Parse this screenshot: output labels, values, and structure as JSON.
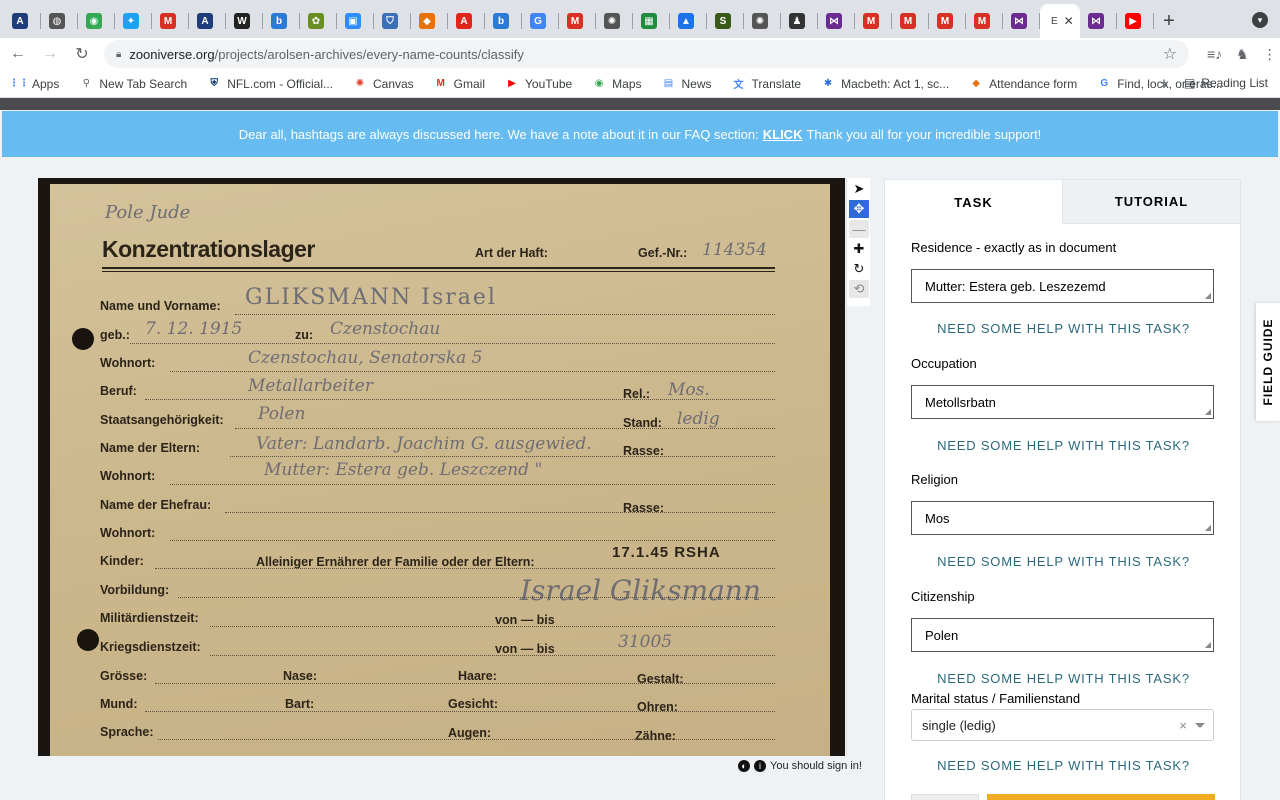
{
  "browser": {
    "tabs": [
      {
        "icon": "arolsen-icon",
        "color": "#1f3d7a",
        "glyph": "A"
      },
      {
        "icon": "globe-icon",
        "color": "#555555",
        "glyph": "◍"
      },
      {
        "icon": "maps-icon",
        "color": "#34a853",
        "glyph": "◉"
      },
      {
        "icon": "twitter-icon",
        "color": "#1da1f2",
        "glyph": "✦"
      },
      {
        "icon": "gmail-icon",
        "color": "#d93025",
        "glyph": "M"
      },
      {
        "icon": "arolsen-icon",
        "color": "#1f3d7a",
        "glyph": "A"
      },
      {
        "icon": "wikipedia-icon",
        "color": "#222222",
        "glyph": "W"
      },
      {
        "icon": "bing-icon",
        "color": "#2b7bd6",
        "glyph": "b"
      },
      {
        "icon": "badge-icon",
        "color": "#6b8e23",
        "glyph": "✿"
      },
      {
        "icon": "zoom-icon",
        "color": "#2d8cff",
        "glyph": "▣"
      },
      {
        "icon": "shield-icon",
        "color": "#3b6fb6",
        "glyph": "⛉"
      },
      {
        "icon": "attendance-icon",
        "color": "#e8710a",
        "glyph": "◆"
      },
      {
        "icon": "adobe-icon",
        "color": "#e1251b",
        "glyph": "A"
      },
      {
        "icon": "bing-icon",
        "color": "#2b7bd6",
        "glyph": "b"
      },
      {
        "icon": "google-icon",
        "color": "#4285f4",
        "glyph": "G"
      },
      {
        "icon": "gmail-icon",
        "color": "#d93025",
        "glyph": "M"
      },
      {
        "icon": "dotted-circle-icon",
        "color": "#555555",
        "glyph": "✺"
      },
      {
        "icon": "classroom-icon",
        "color": "#1e8e3e",
        "glyph": "▦"
      },
      {
        "icon": "contacts-icon",
        "color": "#1a73e8",
        "glyph": "▲"
      },
      {
        "icon": "sketch-icon",
        "color": "#3a5a1a",
        "glyph": "S"
      },
      {
        "icon": "dotted-circle-icon",
        "color": "#555555",
        "glyph": "✺"
      },
      {
        "icon": "person-icon",
        "color": "#333333",
        "glyph": "♟"
      },
      {
        "icon": "zooniverse-icon",
        "color": "#6b2c91",
        "glyph": "⋈"
      },
      {
        "icon": "gmail-icon",
        "color": "#d93025",
        "glyph": "M"
      },
      {
        "icon": "gmail-icon",
        "color": "#d93025",
        "glyph": "M"
      },
      {
        "icon": "gmail-icon",
        "color": "#d93025",
        "glyph": "M"
      },
      {
        "icon": "gmail-icon",
        "color": "#d93025",
        "glyph": "M"
      },
      {
        "icon": "zooniverse-icon",
        "color": "#6b2c91",
        "glyph": "⋈"
      }
    ],
    "active_tab_label": "E",
    "after_tabs": [
      {
        "icon": "zooniverse-icon",
        "color": "#6b2c91",
        "glyph": "⋈"
      },
      {
        "icon": "youtube-icon",
        "color": "#ff0000",
        "glyph": "▶"
      }
    ],
    "url_host": "zooniverse.org",
    "url_path": "/projects/arolsen-archives/every-name-counts/classify",
    "bookmarks": [
      {
        "label": "Apps",
        "icon": "apps-grid-icon",
        "color": "#4285f4",
        "glyph": "⋮⋮"
      },
      {
        "label": "New Tab Search",
        "icon": "search-icon",
        "color": "#5f6368",
        "glyph": "⚲"
      },
      {
        "label": "NFL.com - Official...",
        "icon": "nfl-icon",
        "color": "#013369",
        "glyph": "⛨"
      },
      {
        "label": "Canvas",
        "icon": "canvas-icon",
        "color": "#e13f2b",
        "glyph": "✺"
      },
      {
        "label": "Gmail",
        "icon": "gmail-icon",
        "color": "#d93025",
        "glyph": "M"
      },
      {
        "label": "YouTube",
        "icon": "youtube-icon",
        "color": "#ff0000",
        "glyph": "▶"
      },
      {
        "label": "Maps",
        "icon": "maps-icon",
        "color": "#34a853",
        "glyph": "◉"
      },
      {
        "label": "News",
        "icon": "news-icon",
        "color": "#4285f4",
        "glyph": "▤"
      },
      {
        "label": "Translate",
        "icon": "translate-icon",
        "color": "#4285f4",
        "glyph": "文"
      },
      {
        "label": "Macbeth: Act 1, sc...",
        "icon": "asterisk-icon",
        "color": "#2a6fd6",
        "glyph": "✱"
      },
      {
        "label": "Attendance form",
        "icon": "attendance-icon",
        "color": "#e8710a",
        "glyph": "◆"
      },
      {
        "label": "Find, lock, or eras...",
        "icon": "google-icon",
        "color": "#4285f4",
        "glyph": "G"
      }
    ],
    "bookmarks_more": "»",
    "reading_list": "Reading List"
  },
  "banner": {
    "before": "Dear all, hashtags are always discussed here. We have a note about it in our FAQ section:",
    "link": "KLICK",
    "after": "Thank you all for your incredible support!"
  },
  "card": {
    "note_top": "Pole Jude",
    "title": "Konzentrationslager",
    "art_der_haft": "Art der Haft:",
    "gef_nr_label": "Gef.-Nr.:",
    "gef_nr": "114354",
    "name_label": "Name und Vorname:",
    "name": "GLIKSMANN Israel",
    "geb_label": "geb.:",
    "geb": "7. 12. 1915",
    "zu_label": "zu:",
    "zu": "Czenstochau",
    "wohnort_label": "Wohnort:",
    "wohnort": "Czenstochau, Senatorska 5",
    "beruf_label": "Beruf:",
    "beruf": "Metallarbeiter",
    "rel_label": "Rel.:",
    "rel": "Mos.",
    "staat_label": "Staatsangehörigkeit:",
    "staat": "Polen",
    "stand_label": "Stand:",
    "stand": "ledig",
    "eltern_label": "Name der Eltern:",
    "eltern": "Vater: Landarb. Joachim G. ausgewied.",
    "rasse_label": "Rasse:",
    "wohnort2_label": "Wohnort:",
    "wohnort2": "Mutter: Estera geb. Leszczend \"",
    "ehefrau_label": "Name der Ehefrau:",
    "rasse2_label": "Rasse:",
    "wohnort3_label": "Wohnort:",
    "kinder_label": "Kinder:",
    "ernaehrer_label": "Alleiniger Ernährer der Familie oder der Eltern:",
    "stamp": "17.1.45 RSHA",
    "vorbildung_label": "Vorbildung:",
    "signature": "Israel Gliksmann",
    "militaer_label": "Militärdienstzeit:",
    "von1": "von — bis",
    "krieg_label": "Kriegsdienstzeit:",
    "von2": "von — bis",
    "number2": "31005",
    "groesse_label": "Grösse:",
    "nase_label": "Nase:",
    "haare_label": "Haare:",
    "gestalt_label": "Gestalt:",
    "mund_label": "Mund:",
    "bart_label": "Bart:",
    "gesicht_label": "Gesicht:",
    "ohren_label": "Ohren:",
    "sprache_label": "Sprache:",
    "augen_label": "Augen:",
    "zaehne_label": "Zähne:"
  },
  "viewer": {
    "tools": [
      {
        "name": "pointer-tool-icon",
        "glyph": "➤",
        "state": "normal"
      },
      {
        "name": "move-tool-icon",
        "glyph": "✥",
        "state": "active"
      },
      {
        "name": "zoom-out-icon",
        "glyph": "—",
        "state": "dim"
      },
      {
        "name": "zoom-in-icon",
        "glyph": "✚",
        "state": "normal"
      },
      {
        "name": "rotate-icon",
        "glyph": "↻",
        "state": "normal"
      },
      {
        "name": "reset-icon",
        "glyph": "⟲",
        "state": "dim"
      }
    ],
    "signin": "You should sign in!"
  },
  "panel": {
    "tab_task": "TASK",
    "tab_tutorial": "TUTORIAL",
    "help_text": "NEED SOME HELP WITH THIS TASK?",
    "fields": [
      {
        "label": "Residence - exactly as in document",
        "value": "Mutter: Estera geb. Leszezemd"
      },
      {
        "label": "Occupation",
        "value": "Metollsrbatn"
      },
      {
        "label": "Religion",
        "value": "Mos"
      },
      {
        "label": "Citizenship",
        "value": "Polen"
      }
    ],
    "marital_label": "Marital status / Familienstand",
    "marital_value": "single (ledig)",
    "marital_clear": "×"
  },
  "field_guide": "FIELD GUIDE"
}
